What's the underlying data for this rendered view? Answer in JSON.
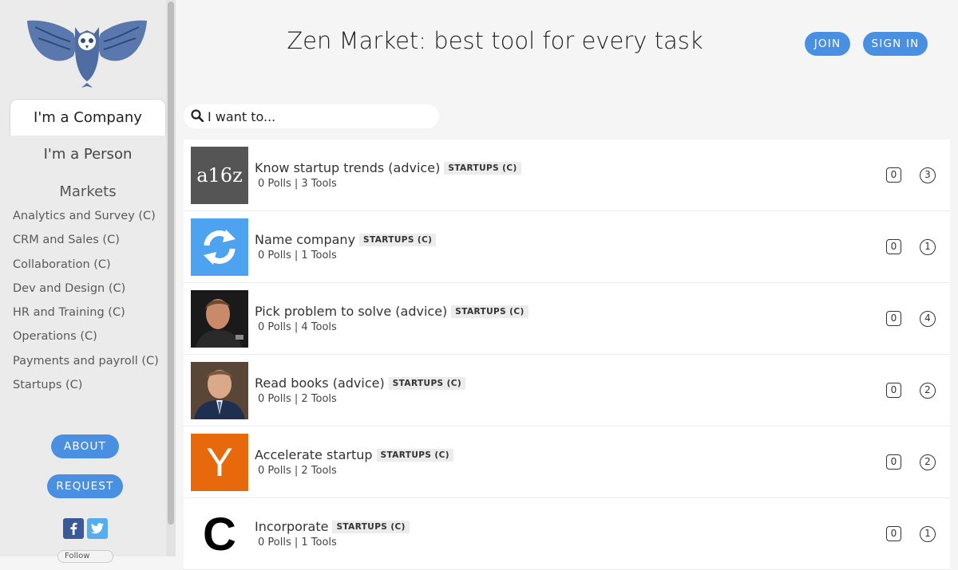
{
  "sidebar": {
    "segments": {
      "company": "I'm a Company",
      "person": "I'm a Person"
    },
    "markets_heading": "Markets",
    "markets": [
      "Analytics and Survey (C)",
      "CRM and Sales (C)",
      "Collaboration (C)",
      "Dev and Design (C)",
      "HR and Training (C)",
      "Operations (C)",
      "Payments and payroll (C)",
      "Startups (C)"
    ],
    "about_label": "ABOUT",
    "request_label": "REQUEST",
    "follow_label": "Follow"
  },
  "header": {
    "title": "Zen Market: best tool for every task",
    "join_label": "JOIN",
    "signin_label": "SIGN IN"
  },
  "search": {
    "placeholder": "I want to..."
  },
  "colors": {
    "accent": "#4a90e2",
    "facebook": "#3b5998",
    "twitter": "#55acee",
    "owl": "#5a78ad"
  },
  "tasks": [
    {
      "title": "Know startup trends (advice)",
      "tag": "STARTUPS (C)",
      "meta": "0 Polls | 3 Tools",
      "box_count": "0",
      "circle_count": "3",
      "thumb_text": "a16z",
      "thumb_icon": "a16z-logo"
    },
    {
      "title": "Name company",
      "tag": "STARTUPS (C)",
      "meta": "0 Polls | 1 Tools",
      "box_count": "0",
      "circle_count": "1",
      "thumb_icon": "refresh-arrows-icon"
    },
    {
      "title": "Pick problem to solve (advice)",
      "tag": "STARTUPS (C)",
      "meta": "0 Polls | 4 Tools",
      "box_count": "0",
      "circle_count": "4",
      "thumb_icon": "person-photo"
    },
    {
      "title": "Read books (advice)",
      "tag": "STARTUPS (C)",
      "meta": "0 Polls | 2 Tools",
      "box_count": "0",
      "circle_count": "2",
      "thumb_icon": "person-photo"
    },
    {
      "title": "Accelerate startup",
      "tag": "STARTUPS (C)",
      "meta": "0 Polls | 2 Tools",
      "box_count": "0",
      "circle_count": "2",
      "thumb_text": "Y",
      "thumb_icon": "ycombinator-logo"
    },
    {
      "title": "Incorporate",
      "tag": "STARTUPS (C)",
      "meta": "0 Polls | 1 Tools",
      "box_count": "0",
      "circle_count": "1",
      "thumb_text": "C",
      "thumb_icon": "c-logo"
    }
  ]
}
